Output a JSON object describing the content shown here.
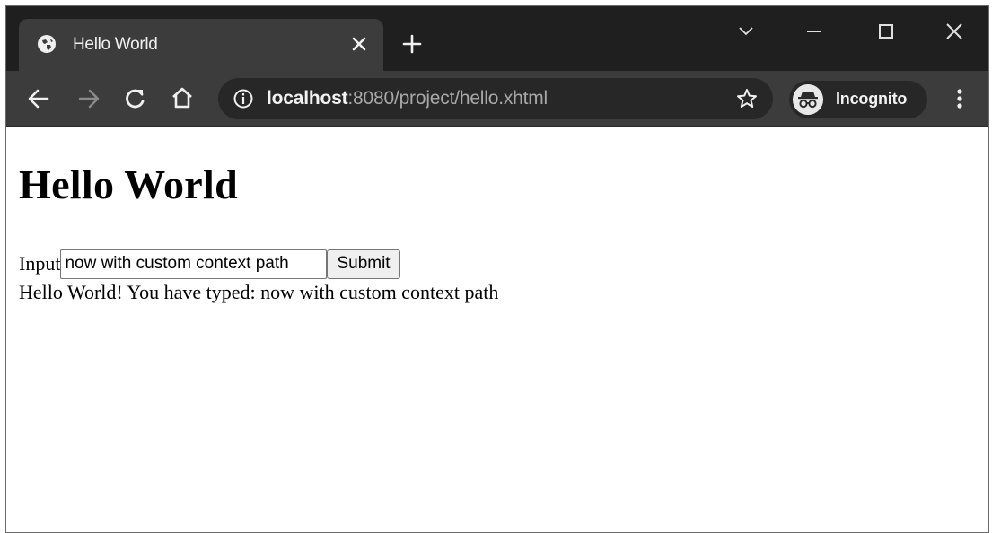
{
  "browser": {
    "tab": {
      "title": "Hello World"
    },
    "address_bar": {
      "host": "localhost",
      "path": ":8080/project/hello.xhtml"
    },
    "profile": {
      "label": "Incognito"
    },
    "icons": [
      "globe-icon",
      "close-icon",
      "plus-icon",
      "chevron-down-icon",
      "minimize-icon",
      "maximize-icon",
      "close-window-icon",
      "back-arrow-icon",
      "forward-arrow-icon",
      "reload-icon",
      "home-icon",
      "info-icon",
      "star-icon",
      "incognito-icon",
      "kebab-menu-icon"
    ],
    "colors": {
      "titlebar": "#1f1f1f",
      "toolbar": "#3c3c3c",
      "omnibox": "#272727"
    }
  },
  "page": {
    "heading": "Hello World",
    "form": {
      "input_label": "Input",
      "input_value": "now with custom context path",
      "submit_label": "Submit"
    },
    "output": "Hello World! You have typed: now with custom context path"
  }
}
